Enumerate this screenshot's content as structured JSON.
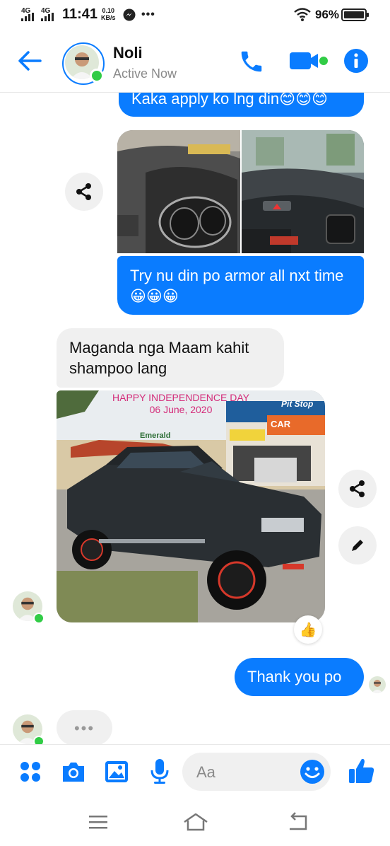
{
  "status_bar": {
    "network_1": "4G",
    "network_2": "4G",
    "time": "11:41",
    "speed_value": "0.10",
    "speed_unit": "KB/s",
    "battery": "96%"
  },
  "header": {
    "contact_name": "Noli",
    "presence": "Active Now"
  },
  "messages": {
    "m1_out": "Kaka apply ko lng din😊😊😊",
    "m2_out": "Try nu din po armor all nxt time😀😀😀",
    "m3_in": "Maganda nga Maam kahit shampoo lang",
    "photo_caption_line1": "HAPPY INDEPENDENCE DAY",
    "photo_caption_line2": "06 June, 2020",
    "photo_sign_1": "Pit Stop",
    "photo_sign_2": "Emerald",
    "photo_sign_3": "CAR",
    "m4_out": "Thank you po",
    "typing": "•••"
  },
  "composer": {
    "placeholder": "Aa"
  },
  "colors": {
    "accent": "#0a7cff",
    "online": "#31cc46"
  }
}
